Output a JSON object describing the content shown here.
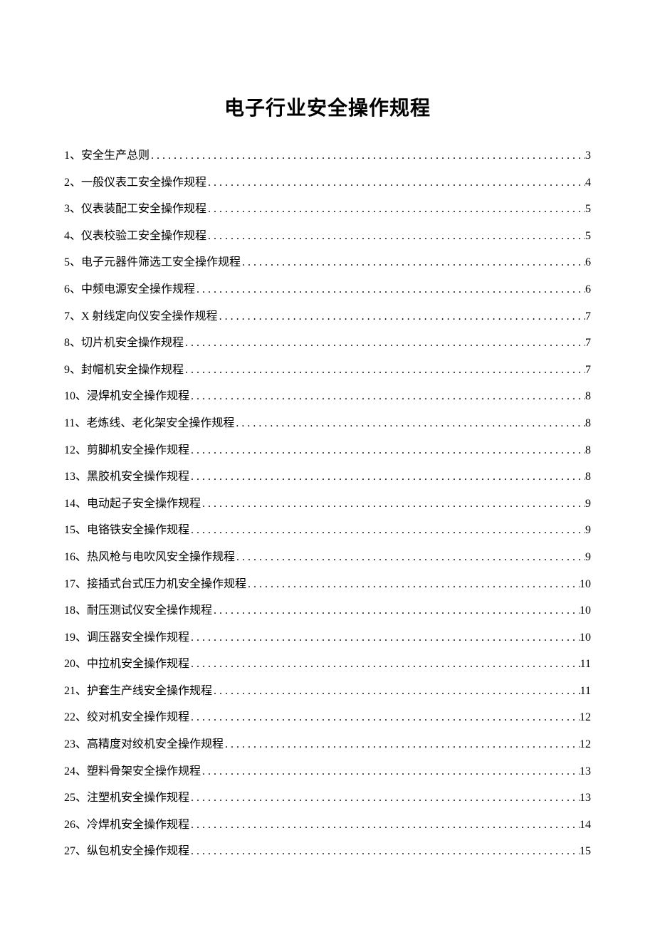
{
  "title": "电子行业安全操作规程",
  "toc": [
    {
      "num": "1、",
      "label": "安全生产总则",
      "page": "3"
    },
    {
      "num": "2、",
      "label": "一般仪表工安全操作规程",
      "page": "4"
    },
    {
      "num": "3、",
      "label": "仪表装配工安全操作规程",
      "page": "5"
    },
    {
      "num": "4、",
      "label": "仪表校验工安全操作规程",
      "page": "5"
    },
    {
      "num": "5、",
      "label": "电子元器件筛选工安全操作规程",
      "page": "6"
    },
    {
      "num": "6、",
      "label": "中频电源安全操作规程",
      "page": "6"
    },
    {
      "num": "7、",
      "label": "X 射线定向仪安全操作规程 ",
      "page": "7"
    },
    {
      "num": "8、",
      "label": "切片机安全操作规程",
      "page": "7"
    },
    {
      "num": "9、",
      "label": "封帽机安全操作规程",
      "page": "7"
    },
    {
      "num": "10、",
      "label": "浸焊机安全操作规程",
      "page": "8"
    },
    {
      "num": "11、",
      "label": "老炼线、老化架安全操作规程",
      "page": "8"
    },
    {
      "num": "12、",
      "label": "剪脚机安全操作规程",
      "page": "8"
    },
    {
      "num": "13、",
      "label": "黑胶机安全操作规程",
      "page": "8"
    },
    {
      "num": "14、",
      "label": "电动起子安全操作规程",
      "page": "9"
    },
    {
      "num": "15、",
      "label": "电铬铁安全操作规程",
      "page": "9"
    },
    {
      "num": "16、",
      "label": "热风枪与电吹风安全操作规程",
      "page": "9"
    },
    {
      "num": "17、",
      "label": "接插式台式压力机安全操作规程",
      "page": "10"
    },
    {
      "num": "18、",
      "label": "耐压测试仪安全操作规程",
      "page": "10"
    },
    {
      "num": "19、",
      "label": "调压器安全操作规程",
      "page": "10"
    },
    {
      "num": "20、",
      "label": "中拉机安全操作规程",
      "page": "11"
    },
    {
      "num": "21、",
      "label": "护套生产线安全操作规程",
      "page": "11"
    },
    {
      "num": "22、",
      "label": "绞对机安全操作规程",
      "page": "12"
    },
    {
      "num": "23、",
      "label": "高精度对绞机安全操作规程",
      "page": "12"
    },
    {
      "num": "24、",
      "label": "塑料骨架安全操作规程",
      "page": "13"
    },
    {
      "num": "25、",
      "label": "注塑机安全操作规程",
      "page": "13"
    },
    {
      "num": "26、",
      "label": "冷焊机安全操作规程",
      "page": "14"
    },
    {
      "num": "27、",
      "label": "纵包机安全操作规程",
      "page": "15"
    }
  ]
}
